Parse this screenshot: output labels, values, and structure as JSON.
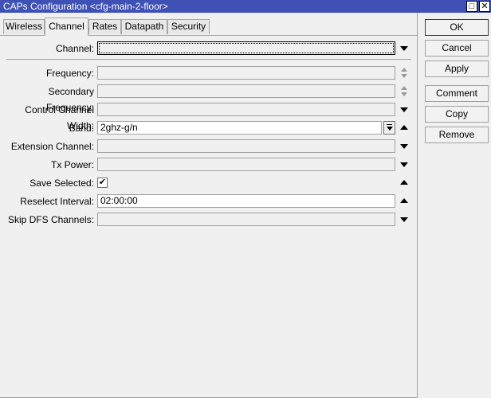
{
  "window": {
    "title": "CAPs Configuration <cfg-main-2-floor>",
    "max_symbol": "□",
    "close_symbol": "✕"
  },
  "tabs": [
    {
      "label": "Wireless"
    },
    {
      "label": "Channel",
      "active": true
    },
    {
      "label": "Rates"
    },
    {
      "label": "Datapath"
    },
    {
      "label": "Security"
    }
  ],
  "fields": {
    "channel": {
      "label": "Channel:",
      "value": ""
    },
    "frequency": {
      "label": "Frequency:",
      "value": ""
    },
    "secondary_frequency": {
      "label": "Secondary Frequency:",
      "value": ""
    },
    "control_channel_width": {
      "label": "Control Channel Width:",
      "value": ""
    },
    "band": {
      "label": "Band:",
      "value": "2ghz-g/n"
    },
    "extension_channel": {
      "label": "Extension Channel:",
      "value": ""
    },
    "tx_power": {
      "label": "Tx Power:",
      "value": ""
    },
    "save_selected": {
      "label": "Save Selected:",
      "checked": "✔"
    },
    "reselect_interval": {
      "label": "Reselect Interval:",
      "value": "02:00:00"
    },
    "skip_dfs_channels": {
      "label": "Skip DFS Channels:",
      "value": ""
    }
  },
  "buttons": {
    "ok": "OK",
    "cancel": "Cancel",
    "apply": "Apply",
    "comment": "Comment",
    "copy": "Copy",
    "remove": "Remove"
  }
}
